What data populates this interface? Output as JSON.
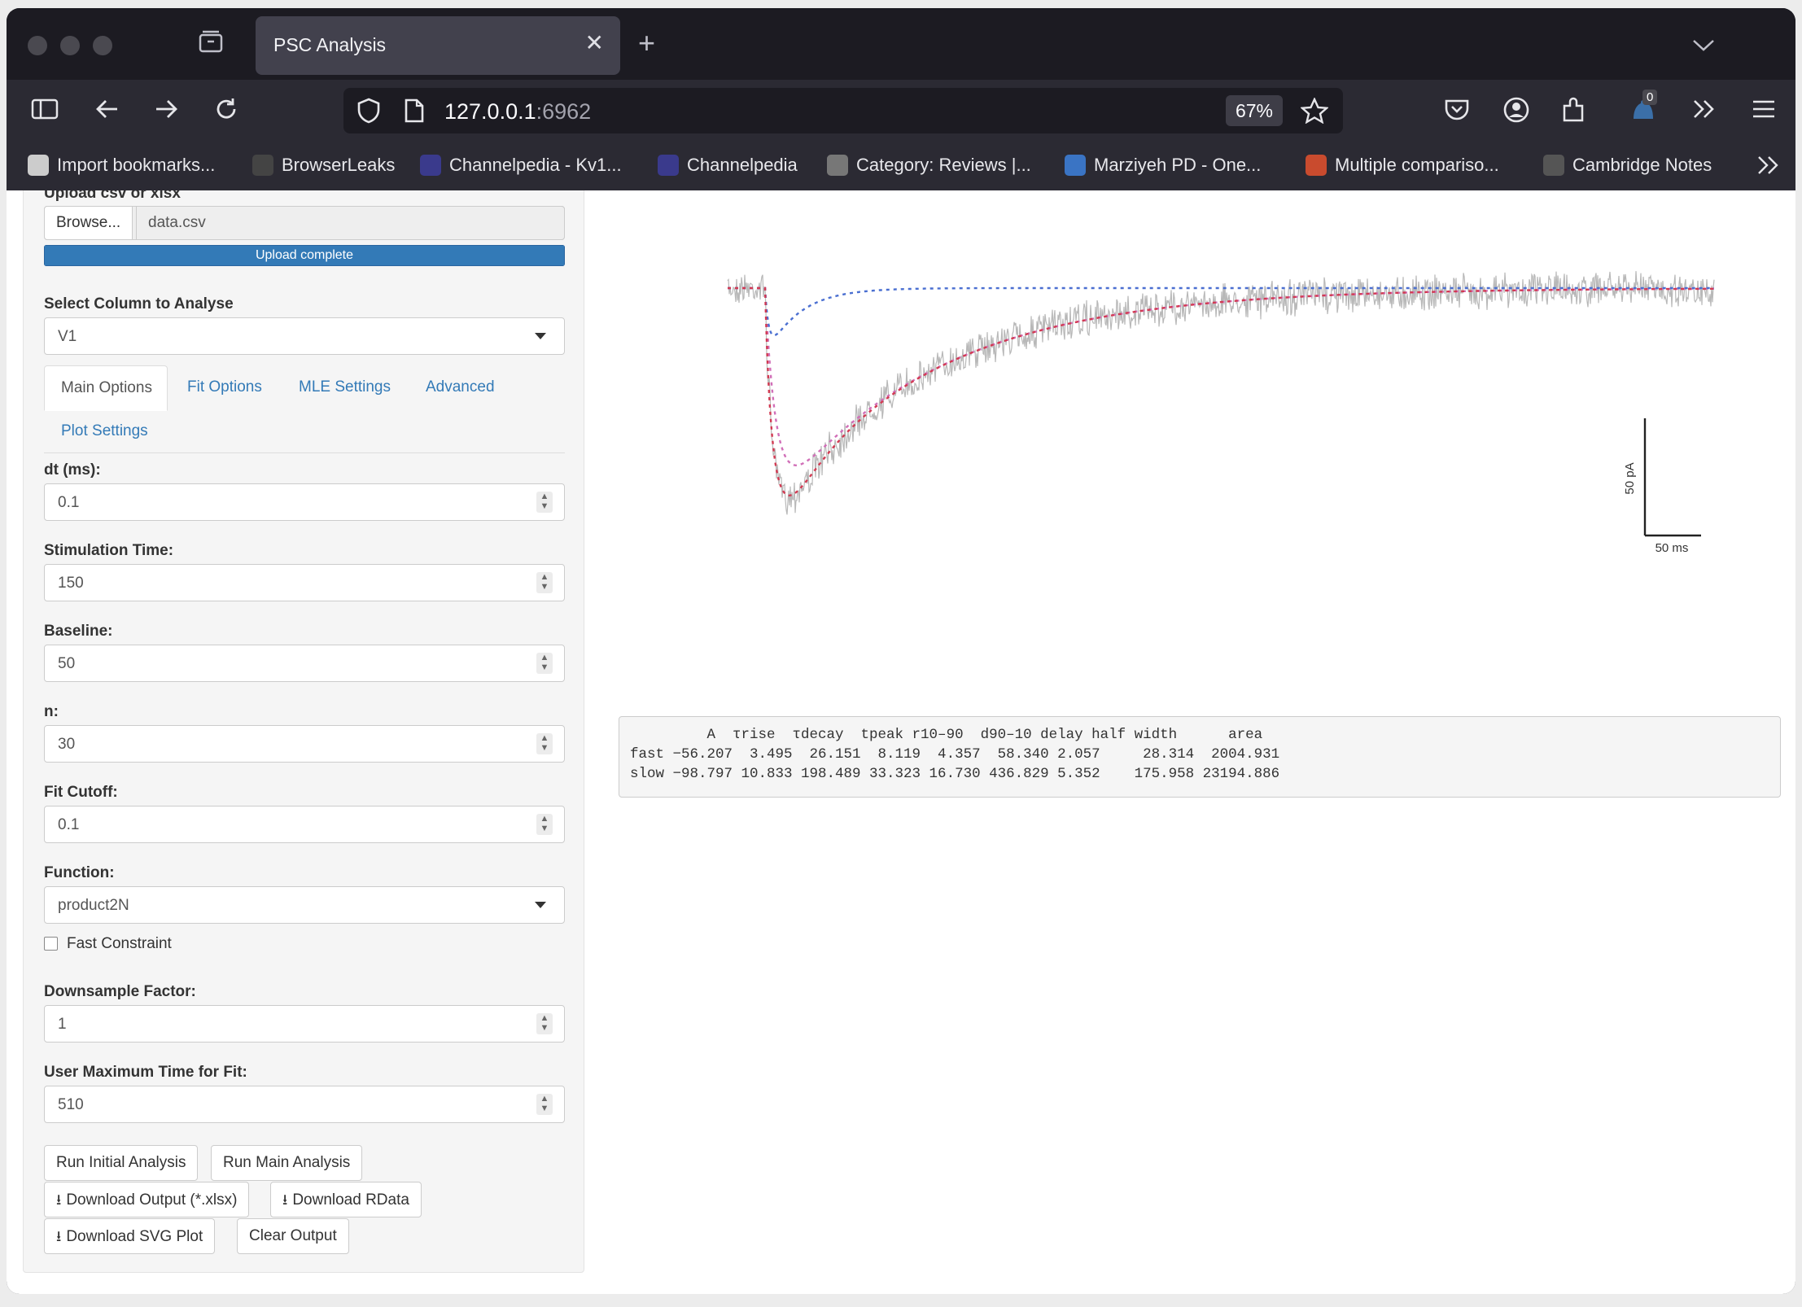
{
  "browser": {
    "tab_title": "PSC Analysis",
    "url_host": "127.0.0.1",
    "url_port": ":6962",
    "zoom": "67%",
    "extension_badge": "0",
    "bookmarks": [
      {
        "label": "Import bookmarks...",
        "icon": "import-icon",
        "color": "#cccccc"
      },
      {
        "label": "BrowserLeaks",
        "icon": "fingerprint-icon",
        "color": "#444444"
      },
      {
        "label": "Channelpedia - Kv1...",
        "icon": "channelpedia-icon",
        "color": "#3a3a8c"
      },
      {
        "label": "Channelpedia",
        "icon": "channelpedia-icon",
        "color": "#3a3a8c"
      },
      {
        "label": "Category: Reviews |...",
        "icon": "headphones-icon",
        "color": "#777777"
      },
      {
        "label": "Marziyeh PD - One...",
        "icon": "onedrive-icon",
        "color": "#3a74c4"
      },
      {
        "label": "Multiple compariso...",
        "icon": "shield-logo-icon",
        "color": "#c94b2e"
      },
      {
        "label": "Cambridge Notes",
        "icon": "gear-logo-icon",
        "color": "#555555"
      }
    ]
  },
  "sidebar": {
    "upload_label": "Upload csv or xlsx",
    "browse_label": "Browse...",
    "file_name": "data.csv",
    "upload_status": "Upload complete",
    "upload_progress": 1.0,
    "column_label": "Select Column to Analyse",
    "column_value": "V1",
    "tabs": [
      "Main Options",
      "Fit Options",
      "MLE Settings",
      "Advanced",
      "Plot Settings"
    ],
    "active_tab": "Main Options",
    "fields": {
      "dt_label": "dt (ms):",
      "dt_value": "0.1",
      "stim_label": "Stimulation Time:",
      "stim_value": "150",
      "baseline_label": "Baseline:",
      "baseline_value": "50",
      "n_label": "n:",
      "n_value": "30",
      "cutoff_label": "Fit Cutoff:",
      "cutoff_value": "0.1",
      "function_label": "Function:",
      "function_value": "product2N",
      "fast_constraint_label": "Fast Constraint",
      "fast_constraint_checked": false,
      "downsample_label": "Downsample Factor:",
      "downsample_value": "1",
      "maxtime_label": "User Maximum Time for Fit:",
      "maxtime_value": "510"
    },
    "buttons": {
      "run_initial": "Run Initial Analysis",
      "run_main": "Run Main Analysis",
      "download_xlsx": "Download Output (*.xlsx)",
      "download_rdata": "Download RData",
      "download_svg": "Download SVG Plot",
      "clear_output": "Clear Output"
    }
  },
  "plot": {
    "scale_y_label": "50 pA",
    "scale_x_label": "50 ms",
    "colors": {
      "trace": "#b8b8b8",
      "fast": "#4a6fd1",
      "slow": "#d16fb8",
      "sum": "#d23a52"
    }
  },
  "results": {
    "header": "         A  τrise  τdecay  tpeak r10–90  d90–10 delay half width      area",
    "row_fast": "fast −56.207  3.495  26.151  8.119  4.357  58.340 2.057     28.314  2004.931",
    "row_slow": "slow −98.797 10.833 198.489 33.323 16.730 436.829 5.352    175.958 23194.886"
  }
}
